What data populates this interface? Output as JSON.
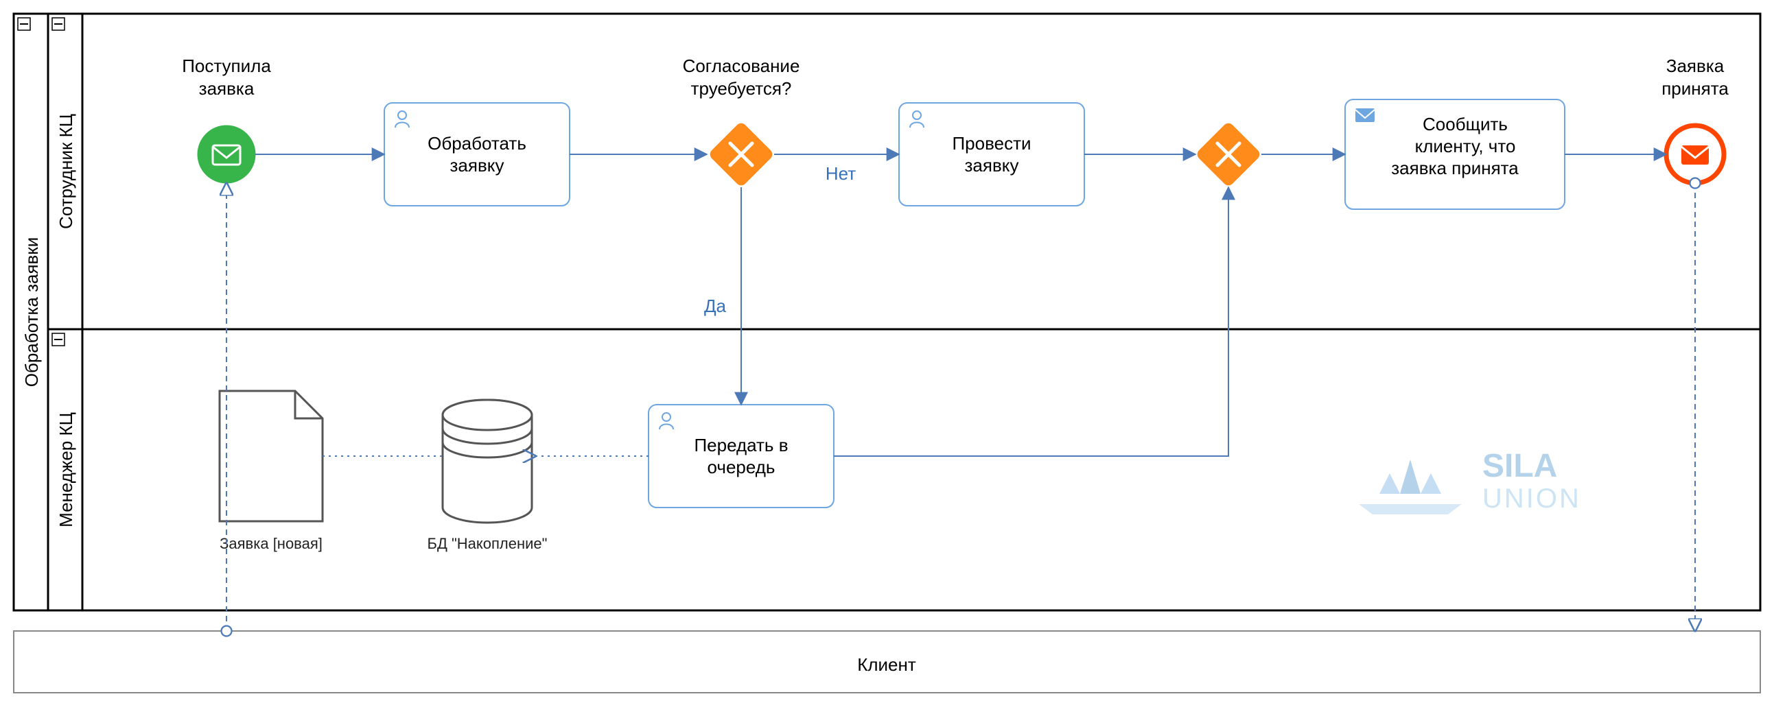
{
  "pool": {
    "title": "Обработка заявки",
    "lanes": [
      {
        "title": "Сотрудник КЦ"
      },
      {
        "title": "Менеджер КЦ"
      }
    ]
  },
  "external_pool": {
    "title": "Клиент"
  },
  "events": {
    "start": {
      "label_line1": "Поступила",
      "label_line2": "заявка"
    },
    "end": {
      "label_line1": "Заявка",
      "label_line2": "принята"
    }
  },
  "tasks": {
    "t1": {
      "line1": "Обработать",
      "line2": "заявку"
    },
    "t2": {
      "line1": "Провести",
      "line2": "заявку"
    },
    "t3": {
      "line1": "Сообщить",
      "line2": "клиенту, что",
      "line3": "заявка принята"
    },
    "t4": {
      "line1": "Передать в",
      "line2": "очередь"
    }
  },
  "gateway": {
    "g1": {
      "label_line1": "Согласование",
      "label_line2": "труебуется?"
    }
  },
  "edge_labels": {
    "no": "Нет",
    "yes": "Да"
  },
  "artifacts": {
    "doc": {
      "label": "Заявка [новая]"
    },
    "db": {
      "label": "БД \"Накопление\""
    }
  },
  "watermark": {
    "line1": "SILA",
    "line2": "UNION"
  }
}
